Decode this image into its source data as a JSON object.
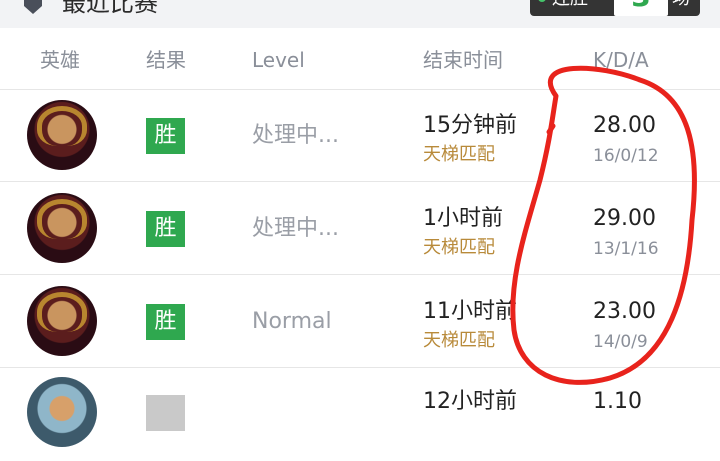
{
  "header": {
    "title": "最近比赛",
    "streak_label": "连胜",
    "streak_count": "3",
    "streak_unit": "场"
  },
  "columns": {
    "hero": "英雄",
    "result": "结果",
    "level": "Level",
    "end_time": "结束时间",
    "kda": "K/D/A"
  },
  "matches": [
    {
      "hero_icon": "invoker-avatar",
      "result": "胜",
      "level": "处理中...",
      "time": "15分钟前",
      "mode": "天梯匹配",
      "kda_score": "28.00",
      "kda": "16/0/12"
    },
    {
      "hero_icon": "invoker-avatar",
      "result": "胜",
      "level": "处理中...",
      "time": "1小时前",
      "mode": "天梯匹配",
      "kda_score": "29.00",
      "kda": "13/1/16"
    },
    {
      "hero_icon": "invoker-avatar",
      "result": "胜",
      "level": "Normal",
      "time": "11小时前",
      "mode": "天梯匹配",
      "kda_score": "23.00",
      "kda": "14/0/9"
    },
    {
      "hero_icon": "hero-avatar",
      "result": "",
      "level": "",
      "time": "12小时前",
      "mode": "",
      "kda_score": "1.10",
      "kda": ""
    }
  ],
  "colors": {
    "win_green": "#2fa84f",
    "annotation_red": "#e8231c",
    "mode_gold": "#b88a3a"
  }
}
